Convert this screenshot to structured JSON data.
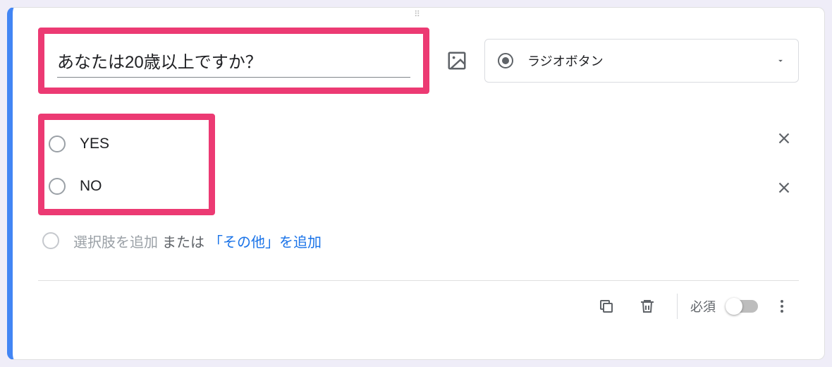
{
  "question": {
    "text": "あなたは20歳以上ですか？"
  },
  "typeSelector": {
    "label": "ラジオボタン"
  },
  "options": [
    {
      "label": "YES"
    },
    {
      "label": "NO"
    }
  ],
  "addRow": {
    "addOption": "選択肢を追加",
    "or": "または",
    "addOther": "「その他」を追加"
  },
  "footer": {
    "required": "必須"
  }
}
